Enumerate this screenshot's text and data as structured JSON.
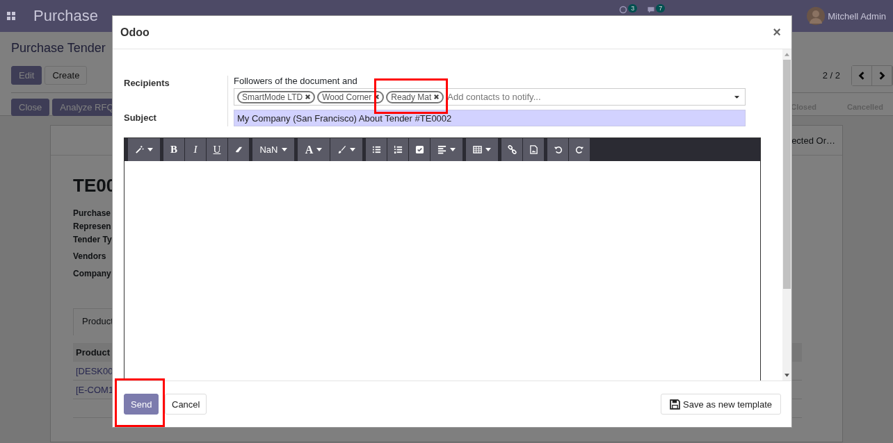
{
  "navbar": {
    "app_name": "Purchase",
    "activity_count": "3",
    "message_count": "7",
    "user": "Mitchell Admin"
  },
  "control_panel": {
    "breadcrumb": "Purchase Tender",
    "buttons": [
      "Edit",
      "Create"
    ],
    "pager": "2 / 2",
    "action_buttons": [
      "Close",
      "Analyze RFQ"
    ],
    "stages": [
      "Closed",
      "Cancelled"
    ]
  },
  "sheet": {
    "smart_button": "ected Or…",
    "title": "TE00",
    "fields": [
      "Purchase",
      "Represen",
      "Tender Ty",
      "Vendors",
      "Company"
    ],
    "tab": "Product",
    "table_header": "Product",
    "rows": [
      "[DESK00",
      "[E-COM1"
    ]
  },
  "dialog": {
    "title": "Odoo",
    "close": "×",
    "recipients_label": "Recipients",
    "recipients_note": "Followers of the document and",
    "tags": [
      {
        "label": "SmartMode LTD",
        "highlighted": false
      },
      {
        "label": "Wood Corner",
        "highlighted": false
      },
      {
        "label": "Ready Mat",
        "highlighted": true
      }
    ],
    "tags_placeholder": "Add contacts to notify...",
    "subject_label": "Subject",
    "subject": "My Company (San Francisco) About Tender #TE0002",
    "toolbar": [
      [
        {
          "kind": "wand"
        }
      ],
      [
        {
          "kind": "bold",
          "label": "B"
        },
        {
          "kind": "italic",
          "label": "I"
        },
        {
          "kind": "underline",
          "label": "U"
        },
        {
          "kind": "eraser"
        }
      ],
      [
        {
          "kind": "fontsize",
          "label": "NaN"
        }
      ],
      [
        {
          "kind": "fontcolor",
          "label": "A"
        },
        {
          "kind": "brush"
        }
      ],
      [
        {
          "kind": "bullets"
        },
        {
          "kind": "numbers"
        },
        {
          "kind": "checklist"
        },
        {
          "kind": "align"
        }
      ],
      [
        {
          "kind": "table"
        }
      ],
      [
        {
          "kind": "link"
        },
        {
          "kind": "image"
        }
      ],
      [
        {
          "kind": "undo"
        },
        {
          "kind": "redo"
        }
      ]
    ],
    "buttons": [
      {
        "label": "Send",
        "kind": "primary",
        "highlighted": true
      },
      {
        "label": "Cancel",
        "kind": "secondary",
        "highlighted": false
      }
    ],
    "template_button": "Save as new template"
  }
}
